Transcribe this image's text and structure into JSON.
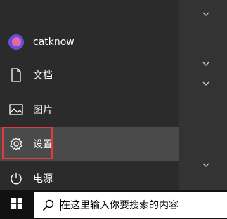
{
  "start_menu": {
    "items": [
      {
        "key": "user",
        "label": "catknow",
        "icon": "user-avatar-icon"
      },
      {
        "key": "documents",
        "label": "文档",
        "icon": "document-icon"
      },
      {
        "key": "pictures",
        "label": "图片",
        "icon": "picture-icon"
      },
      {
        "key": "settings",
        "label": "设置",
        "icon": "gear-icon",
        "highlighted": true
      },
      {
        "key": "power",
        "label": "电源",
        "icon": "power-icon"
      }
    ],
    "highlight_color": "#e23b3b",
    "active_bg": "#4a4a4a"
  },
  "taskbar": {
    "start_icon": "windows-logo-icon",
    "search": {
      "icon": "search-icon",
      "placeholder": "在这里输入你要搜索的内容"
    }
  }
}
